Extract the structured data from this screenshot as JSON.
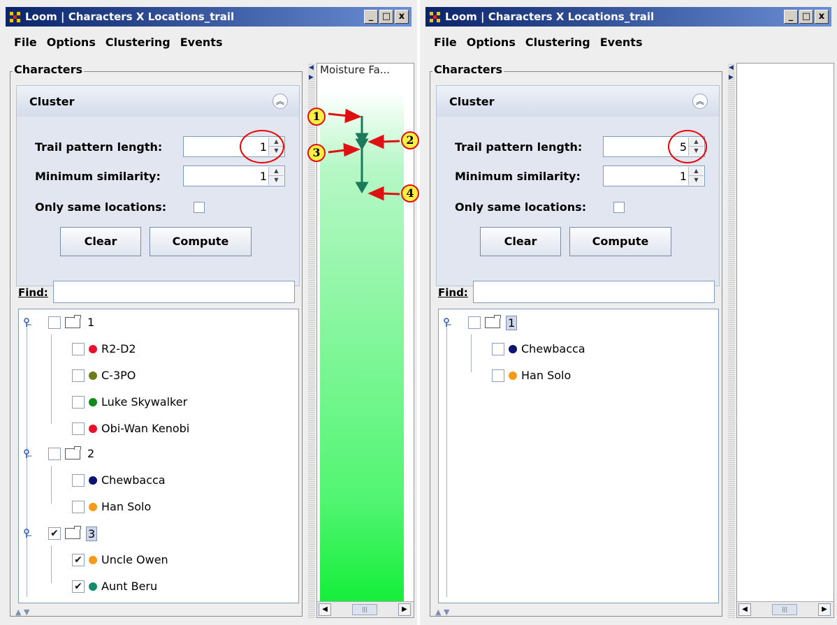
{
  "windows": [
    {
      "title": "Loom | Characters X Locations_trail",
      "window_buttons": [
        "_",
        "□",
        "x"
      ],
      "menu": [
        "File",
        "Options",
        "Clustering",
        "Events"
      ],
      "panel_title": "Characters",
      "cluster": {
        "title": "Cluster",
        "trail_label": "Trail pattern length:",
        "trail_value": "1",
        "similarity_label": "Minimum similarity:",
        "similarity_value": "1",
        "same_locations_label": "Only same locations:",
        "clear_label": "Clear",
        "compute_label": "Compute"
      },
      "find_label": "Find:",
      "tree": [
        {
          "label": "1",
          "checked": false,
          "children": [
            {
              "label": "R2-D2",
              "color": "#e8112d",
              "checked": false
            },
            {
              "label": "C-3PO",
              "color": "#6b7d1a",
              "checked": false
            },
            {
              "label": "Luke Skywalker",
              "color": "#138a1c",
              "checked": false
            },
            {
              "label": "Obi-Wan Kenobi",
              "color": "#e8112d",
              "checked": false
            }
          ]
        },
        {
          "label": "2",
          "checked": false,
          "children": [
            {
              "label": "Chewbacca",
              "color": "#0b1473",
              "checked": false
            },
            {
              "label": "Han Solo",
              "color": "#f59a1a",
              "checked": false
            }
          ]
        },
        {
          "label": "3",
          "checked": true,
          "children": [
            {
              "label": "Uncle Owen",
              "color": "#f59a1a",
              "checked": true
            },
            {
              "label": "Aunt Beru",
              "color": "#168a6d",
              "checked": true
            }
          ]
        }
      ],
      "timeline_header": "Moisture Fa...",
      "callouts": [
        "1",
        "2",
        "3",
        "4"
      ]
    },
    {
      "title": "Loom | Characters X Locations_trail",
      "window_buttons": [
        "_",
        "□",
        "x"
      ],
      "menu": [
        "File",
        "Options",
        "Clustering",
        "Events"
      ],
      "panel_title": "Characters",
      "cluster": {
        "title": "Cluster",
        "trail_label": "Trail pattern length:",
        "trail_value": "5",
        "similarity_label": "Minimum similarity:",
        "similarity_value": "1",
        "same_locations_label": "Only same locations:",
        "clear_label": "Clear",
        "compute_label": "Compute"
      },
      "find_label": "Find:",
      "tree": [
        {
          "label": "1",
          "checked": false,
          "children": [
            {
              "label": "Chewbacca",
              "color": "#0b1473",
              "checked": false
            },
            {
              "label": "Han Solo",
              "color": "#f59a1a",
              "checked": false
            }
          ]
        }
      ],
      "timeline_header": "",
      "callouts": []
    }
  ],
  "colors": {
    "titlebar": "#0a246a",
    "trail_arrow": "#1a7a5a",
    "callout_fill": "#ffee44",
    "callout_border": "#dd1111"
  }
}
